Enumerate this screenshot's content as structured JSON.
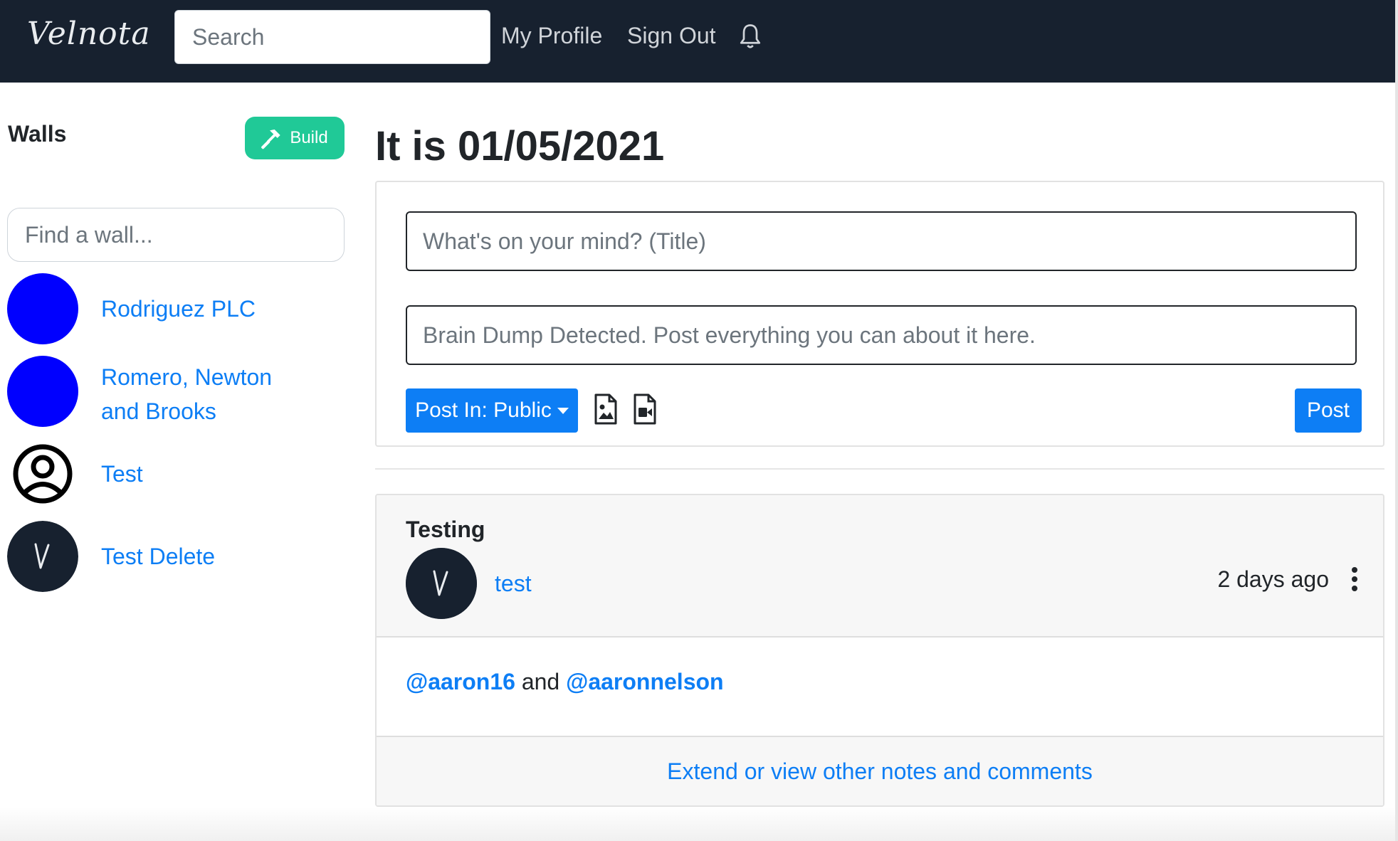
{
  "nav": {
    "brand": "Velnota",
    "search_placeholder": "Search",
    "links": [
      "My Profile",
      "Sign Out"
    ],
    "bell_icon": "bell-icon"
  },
  "sidebar": {
    "title": "Walls",
    "build_label": "Build",
    "build_icon": "hammer-icon",
    "find_placeholder": "Find a wall...",
    "walls": [
      {
        "name": "Rodriguez PLC",
        "avatar": "blue-circle"
      },
      {
        "name_line1": "Romero, Newton",
        "name_line2": "and Brooks",
        "avatar": "blue-circle"
      },
      {
        "name": "Test",
        "avatar": "user-circle-icon"
      },
      {
        "name": "Test Delete",
        "avatar": "velnota-logo"
      }
    ]
  },
  "main": {
    "date_heading": "It is 01/05/2021",
    "compose": {
      "title_placeholder": "What's on your mind? (Title)",
      "body_placeholder": "Brain Dump Detected. Post everything you can about it here.",
      "post_in_label": "Post In: Public",
      "post_label": "Post",
      "image_icon": "file-image-icon",
      "video_icon": "file-video-icon"
    },
    "post": {
      "title": "Testing",
      "author": "test",
      "time": "2 days ago",
      "avatar_letter": "V",
      "body": {
        "mention1": "@aaron16",
        "connector": "and",
        "mention2": "@aaronnelson"
      },
      "footer_link": "Extend or view other notes and comments"
    }
  },
  "colors": {
    "navbar": "#17212f",
    "accent": "#0d7ef5",
    "build": "#20c997",
    "avatar_blue": "#0000ff"
  }
}
